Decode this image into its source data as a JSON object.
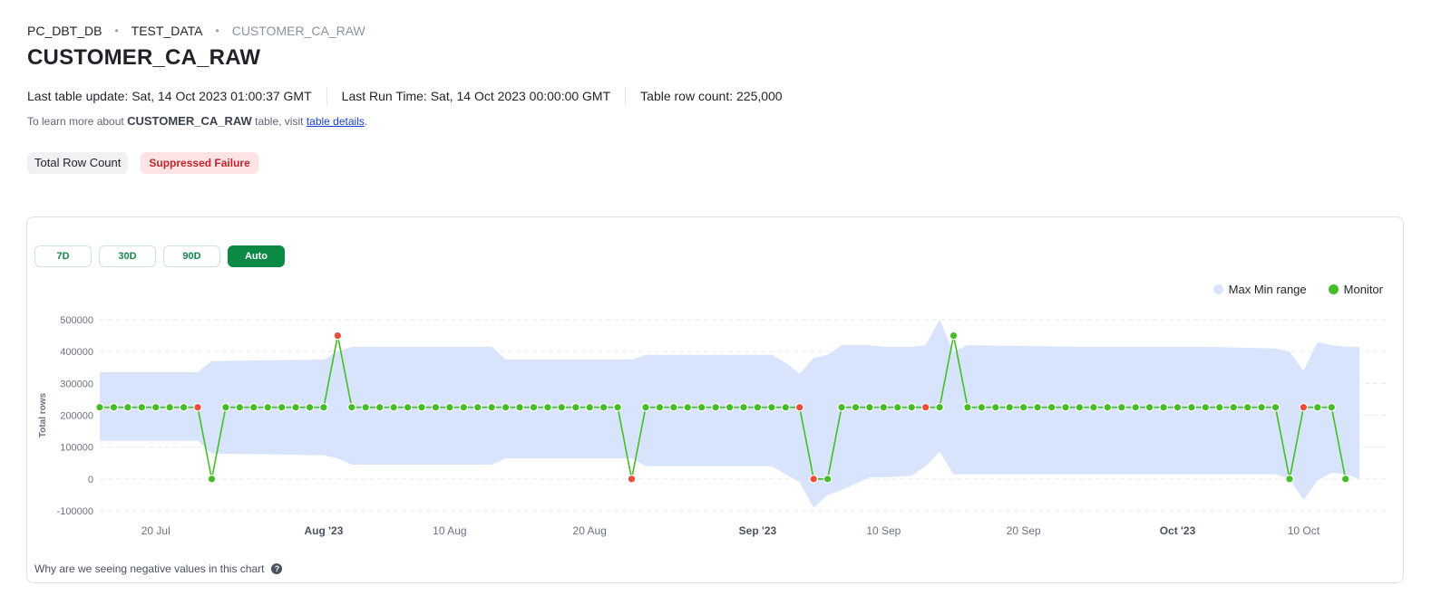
{
  "breadcrumb": [
    "PC_DBT_DB",
    "TEST_DATA",
    "CUSTOMER_CA_RAW"
  ],
  "title": "CUSTOMER_CA_RAW",
  "meta": {
    "last_update": "Last table update: Sat, 14 Oct 2023 01:00:37 GMT",
    "last_run": "Last Run Time: Sat, 14 Oct 2023 00:00:00 GMT",
    "row_count": "Table row count: 225,000"
  },
  "learn": {
    "prefix": "To learn more about ",
    "table": "CUSTOMER_CA_RAW",
    "middle": " table, visit ",
    "link": "table details",
    "suffix": "."
  },
  "tags": {
    "metric": "Total Row Count",
    "status": "Suppressed Failure"
  },
  "ranges": [
    "7D",
    "30D",
    "90D",
    "Auto"
  ],
  "active_range": "Auto",
  "footer": {
    "text": "Why are we seeing negative values in this chart",
    "help_icon": "question-circle-icon"
  },
  "colors": {
    "range": "#d8e4fc",
    "monitor": "#44bd27",
    "anomaly": "#f04a3a",
    "accent": "#0b8a45"
  },
  "chart_data": {
    "type": "line",
    "ylabel": "Total rows",
    "ylim": [
      -100000,
      500000
    ],
    "yticks": [
      500000,
      400000,
      300000,
      200000,
      100000,
      0,
      -100000
    ],
    "ytick_labels": [
      "500000",
      "400000",
      "300000",
      "200000",
      "100000",
      "0",
      "-100000"
    ],
    "xlim": [
      "2023-07-16",
      "2023-10-16"
    ],
    "xticks": [
      {
        "date": "2023-07-20",
        "label": "20 Jul",
        "bold": false
      },
      {
        "date": "2023-08-01",
        "label": "Aug '23",
        "bold": true
      },
      {
        "date": "2023-08-10",
        "label": "10 Aug",
        "bold": false
      },
      {
        "date": "2023-08-20",
        "label": "20 Aug",
        "bold": false
      },
      {
        "date": "2023-09-01",
        "label": "Sep '23",
        "bold": true
      },
      {
        "date": "2023-09-10",
        "label": "10 Sep",
        "bold": false
      },
      {
        "date": "2023-09-20",
        "label": "20 Sep",
        "bold": false
      },
      {
        "date": "2023-10-01",
        "label": "Oct '23",
        "bold": true
      },
      {
        "date": "2023-10-10",
        "label": "10 Oct",
        "bold": false
      }
    ],
    "legend": [
      "Max Min range",
      "Monitor"
    ],
    "legend_position": "top-right",
    "grid": true,
    "series": [
      {
        "name": "Monitor",
        "start_date": "2023-07-16",
        "anomaly_value_dates": [
          "2023-07-23",
          "2023-08-02",
          "2023-08-23",
          "2023-09-04",
          "2023-09-05",
          "2023-09-13",
          "2023-10-10",
          "2023-10-14"
        ],
        "values": [
          225000,
          225000,
          225000,
          225000,
          225000,
          225000,
          225000,
          225000,
          0,
          225000,
          225000,
          225000,
          225000,
          225000,
          225000,
          225000,
          225000,
          450000,
          225000,
          225000,
          225000,
          225000,
          225000,
          225000,
          225000,
          225000,
          225000,
          225000,
          225000,
          225000,
          225000,
          225000,
          225000,
          225000,
          225000,
          225000,
          225000,
          225000,
          0,
          225000,
          225000,
          225000,
          225000,
          225000,
          225000,
          225000,
          225000,
          225000,
          225000,
          225000,
          225000,
          0,
          0,
          225000,
          225000,
          225000,
          225000,
          225000,
          225000,
          225000,
          225000,
          450000,
          225000,
          225000,
          225000,
          225000,
          225000,
          225000,
          225000,
          225000,
          225000,
          225000,
          225000,
          225000,
          225000,
          225000,
          225000,
          225000,
          225000,
          225000,
          225000,
          225000,
          225000,
          225000,
          225000,
          0,
          225000,
          225000,
          225000,
          0
        ]
      },
      {
        "name": "Max Min range",
        "dates": [
          "2023-07-16",
          "2023-07-23",
          "2023-07-24",
          "2023-08-01",
          "2023-08-02",
          "2023-08-03",
          "2023-08-13",
          "2023-08-14",
          "2023-08-23",
          "2023-08-24",
          "2023-09-02",
          "2023-09-03",
          "2023-09-04",
          "2023-09-05",
          "2023-09-06",
          "2023-09-07",
          "2023-09-09",
          "2023-09-10",
          "2023-09-12",
          "2023-09-13",
          "2023-09-14",
          "2023-09-15",
          "2023-09-16",
          "2023-09-24",
          "2023-10-03",
          "2023-10-08",
          "2023-10-09",
          "2023-10-10",
          "2023-10-11",
          "2023-10-12",
          "2023-10-13",
          "2023-10-14"
        ],
        "upper": [
          335000,
          335000,
          370000,
          375000,
          400000,
          415000,
          415000,
          375000,
          375000,
          390000,
          390000,
          365000,
          330000,
          380000,
          390000,
          420000,
          420000,
          415000,
          415000,
          420000,
          500000,
          400000,
          420000,
          415000,
          415000,
          410000,
          400000,
          340000,
          430000,
          420000,
          415000,
          415000
        ],
        "lower": [
          120000,
          120000,
          80000,
          75000,
          65000,
          45000,
          45000,
          65000,
          65000,
          40000,
          40000,
          15000,
          -10000,
          -90000,
          -50000,
          -35000,
          5000,
          5000,
          10000,
          40000,
          85000,
          15000,
          15000,
          15000,
          15000,
          15000,
          0,
          -65000,
          -5000,
          20000,
          15000,
          0
        ]
      }
    ]
  }
}
